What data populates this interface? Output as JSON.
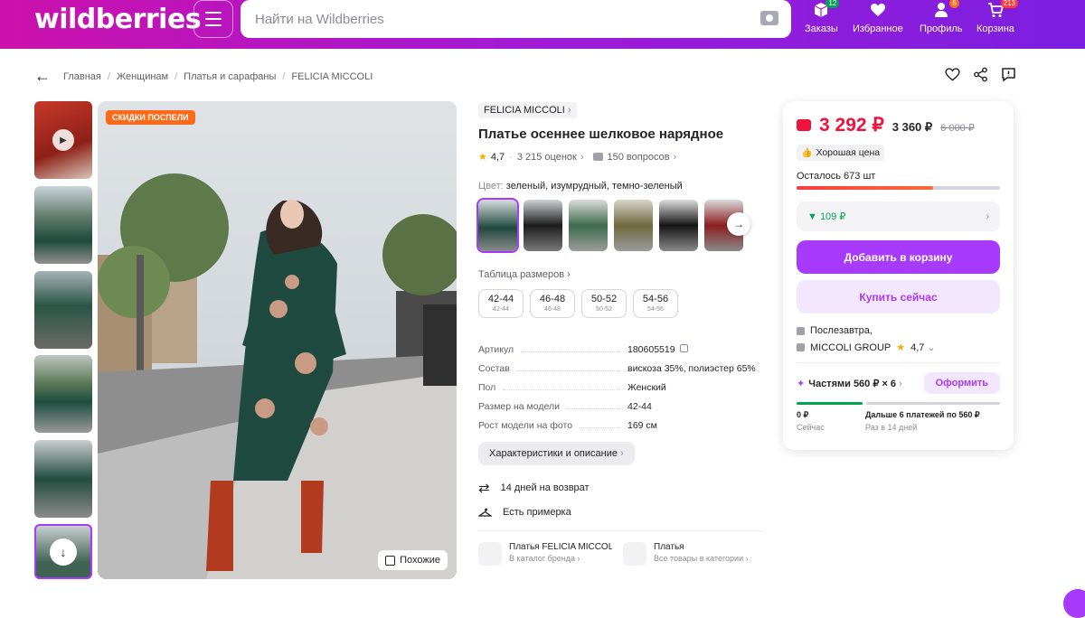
{
  "header": {
    "logo": "wildberries",
    "search_placeholder": "Найти на Wildberries",
    "nav": [
      {
        "label": "Заказы",
        "count": "12",
        "icon": "box-icon",
        "count_color": "#00a64f"
      },
      {
        "label": "Избранное",
        "count": "",
        "icon": "heart-icon",
        "count_color": ""
      },
      {
        "label": "Профиль",
        "count": "6",
        "icon": "profile-icon",
        "count_color": "#ff6a1a"
      },
      {
        "label": "Корзина",
        "count": "213",
        "icon": "cart-icon",
        "count_color": "#ff3b3b"
      }
    ]
  },
  "breadcrumbs": [
    "Главная",
    "Женщинам",
    "Платья и сарафаны",
    "FELICIA MICCOLI"
  ],
  "gallery": {
    "badge": "СКИДКИ ПОСПЕЛИ",
    "similar_label": "Похожие"
  },
  "product": {
    "brand": "FELICIA MICCOLI",
    "title": "Платье осеннее шелковое нарядное",
    "rating": "4,7",
    "reviews": "3 215 оценок",
    "questions": "150 вопросов",
    "color_label": "Цвет:",
    "color_value": "зеленый, изумрудный, темно-зеленый",
    "size_table_label": "Таблица размеров",
    "sizes": [
      {
        "main": "42-44",
        "sub": "42-44"
      },
      {
        "main": "46-48",
        "sub": "46-48"
      },
      {
        "main": "50-52",
        "sub": "50-52"
      },
      {
        "main": "54-56",
        "sub": "54-56"
      }
    ],
    "properties": [
      {
        "key": "Артикул",
        "value": "180605519"
      },
      {
        "key": "Состав",
        "value": "вискоза 35%, полиэстер 65%"
      },
      {
        "key": "Пол",
        "value": "Женский"
      },
      {
        "key": "Размер на модели",
        "value": "42-44"
      },
      {
        "key": "Рост модели на фото",
        "value": "169 см"
      }
    ],
    "characteristics_button": "Характеристики и описание",
    "return_text": "14 дней на возврат",
    "fitting_text": "Есть примерка",
    "brand_card": {
      "title": "Платья FELICIA MICCOLI",
      "sub": "В каталог бренда"
    },
    "category_card": {
      "title": "Платья",
      "sub": "Все товары в категории"
    }
  },
  "buybox": {
    "price": "3 292 ₽",
    "price_wallet_less": "3 360 ₽",
    "old_price": "6 000 ₽",
    "good_price": "Хорошая цена",
    "stock_left": "Осталось 673 шт",
    "stock_fraction": 0.67,
    "cashback": "▼ 109 ₽",
    "add_to_cart": "Добавить в корзину",
    "buy_now": "Купить сейчас",
    "delivery": "Послезавтра,",
    "seller": "MICCOLI GROUP",
    "seller_rating": "4,7",
    "installments": "Частями 560 ₽ × 6",
    "installments_button": "Оформить",
    "pay_now": "0 ₽",
    "pay_now_sub": "Сейчас",
    "pay_later": "Дальше 6 платежей по 560 ₽",
    "pay_later_sub": "Раз в 14 дней"
  },
  "colors": {
    "brand_purple": "#a73afd",
    "price_red": "#f1123b",
    "badge_orange": "#ff6a1a",
    "cashback_green": "#00a64f"
  }
}
